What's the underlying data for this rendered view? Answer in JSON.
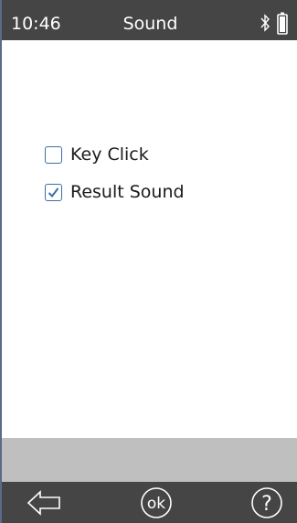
{
  "status_bar": {
    "time": "10:46",
    "title": "Sound",
    "icons": [
      "bluetooth-icon",
      "battery-icon"
    ]
  },
  "options": [
    {
      "label": "Key Click",
      "checked": false
    },
    {
      "label": "Result Sound",
      "checked": true
    }
  ],
  "nav": {
    "back_icon": "back-arrow-icon",
    "ok_label": "ok",
    "help_label": "?"
  },
  "colors": {
    "bar_background": "#454545",
    "band_background": "#bfbfbf",
    "checkbox_accent": "#3b6ea8"
  }
}
